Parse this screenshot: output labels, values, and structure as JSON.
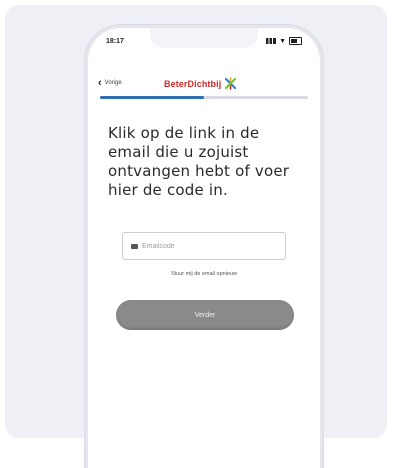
{
  "status_bar": {
    "time": "18:17"
  },
  "nav": {
    "back_label": "Vorige",
    "logo_text": "BeterDichtbij"
  },
  "progress": {
    "value": 0.5,
    "color": "#2f6eb0"
  },
  "main": {
    "heading": "Klik op de link in de email die u zojuist ontvangen hebt of voer hier de code in.",
    "code_input": {
      "placeholder": "Emailcode",
      "value": ""
    },
    "resend_link": "Stuur mij de email opnieuw",
    "next_button": "Verder"
  },
  "colors": {
    "brand_red": "#cf2a27",
    "button_grey": "#8a8a8a"
  }
}
